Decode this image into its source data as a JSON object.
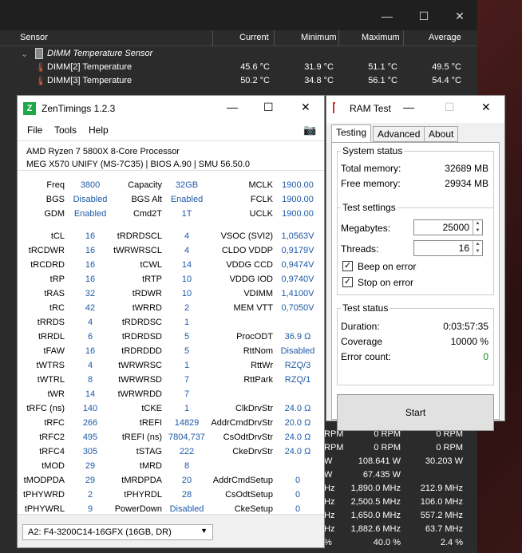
{
  "hwinfo": {
    "columns": [
      "Sensor",
      "Current",
      "Minimum",
      "Maximum",
      "Average"
    ],
    "group": "DIMM Temperature Sensor",
    "rows": [
      {
        "name": "DIMM[2] Temperature",
        "current": "45.6 °C",
        "min": "31.9 °C",
        "max": "51.1 °C",
        "avg": "49.5 °C"
      },
      {
        "name": "DIMM[3] Temperature",
        "current": "50.2 °C",
        "min": "34.8 °C",
        "max": "56.1 °C",
        "avg": "54.4 °C"
      }
    ],
    "lower_rows": [
      {
        "c": "RPM",
        "min": "0 RPM",
        "avg": "0 RPM"
      },
      {
        "c": "RPM",
        "min": "0 RPM",
        "avg": "0 RPM"
      },
      {
        "c": "W",
        "min": "108.641 W",
        "avg": "30.203 W"
      },
      {
        "c": "W",
        "min": "67.435 W",
        "avg": ""
      },
      {
        "c": "Hz",
        "min": "1,890.0 MHz",
        "avg": "212.9 MHz"
      },
      {
        "c": "Hz",
        "min": "2,500.5 MHz",
        "avg": "106.0 MHz"
      },
      {
        "c": "Hz",
        "min": "1,650.0 MHz",
        "avg": "557.2 MHz"
      },
      {
        "c": "Hz",
        "min": "1,882.6 MHz",
        "avg": "63.7 MHz"
      },
      {
        "c": "%",
        "min": "40.0 %",
        "avg": "2.4 %"
      }
    ]
  },
  "zentimings": {
    "title": "ZenTimings 1.2.3",
    "menu": [
      "File",
      "Tools",
      "Help"
    ],
    "cpu": "AMD Ryzen 7 5800X 8-Core Processor",
    "board": "MEG X570 UNIFY (MS-7C35) | BIOS A.90 | SMU 56.50.0",
    "top": [
      [
        "Freq",
        "3800",
        "Capacity",
        "32GB",
        "MCLK",
        "1900.00"
      ],
      [
        "BGS",
        "Disabled",
        "BGS Alt",
        "Enabled",
        "FCLK",
        "1900.00"
      ],
      [
        "GDM",
        "Enabled",
        "Cmd2T",
        "1T",
        "UCLK",
        "1900.00"
      ]
    ],
    "timings": [
      [
        "tCL",
        "16",
        "tRDRDSCL",
        "4",
        "VSOC (SVI2)",
        "1,0563V"
      ],
      [
        "tRCDWR",
        "16",
        "tWRWRSCL",
        "4",
        "CLDO VDDP",
        "0,9179V"
      ],
      [
        "tRCDRD",
        "16",
        "tCWL",
        "14",
        "VDDG CCD",
        "0,9474V"
      ],
      [
        "tRP",
        "16",
        "tRTP",
        "10",
        "VDDG IOD",
        "0,9740V"
      ],
      [
        "tRAS",
        "32",
        "tRDWR",
        "10",
        "VDIMM",
        "1,4100V"
      ],
      [
        "tRC",
        "42",
        "tWRRD",
        "2",
        "MEM VTT",
        "0,7050V"
      ],
      [
        "tRRDS",
        "4",
        "tRDRDSC",
        "1",
        "",
        ""
      ],
      [
        "tRRDL",
        "6",
        "tRDRDSD",
        "5",
        "ProcODT",
        "36.9 Ω"
      ],
      [
        "tFAW",
        "16",
        "tRDRDDD",
        "5",
        "RttNom",
        "Disabled"
      ],
      [
        "tWTRS",
        "4",
        "tWRWRSC",
        "1",
        "RttWr",
        "RZQ/3"
      ],
      [
        "tWTRL",
        "8",
        "tWRWRSD",
        "7",
        "RttPark",
        "RZQ/1"
      ],
      [
        "tWR",
        "14",
        "tWRWRDD",
        "7",
        "",
        ""
      ],
      [
        "tRFC (ns)",
        "140",
        "tCKE",
        "1",
        "ClkDrvStr",
        "24.0 Ω"
      ],
      [
        "tRFC",
        "266",
        "tREFI",
        "14829",
        "AddrCmdDrvStr",
        "20.0 Ω"
      ],
      [
        "tRFC2",
        "495",
        "tREFI (ns)",
        "7804,737",
        "CsOdtDrvStr",
        "24.0 Ω"
      ],
      [
        "tRFC4",
        "305",
        "tSTAG",
        "222",
        "CkeDrvStr",
        "24.0 Ω"
      ],
      [
        "tMOD",
        "29",
        "tMRD",
        "8",
        "",
        ""
      ],
      [
        "tMODPDA",
        "29",
        "tMRDPDA",
        "20",
        "AddrCmdSetup",
        "0"
      ],
      [
        "tPHYWRD",
        "2",
        "tPHYRDL",
        "28",
        "CsOdtSetup",
        "0"
      ],
      [
        "tPHYWRL",
        "9",
        "PowerDown",
        "Disabled",
        "CkeSetup",
        "0"
      ]
    ],
    "dimm_select": "A2: F4-3200C14-16GFX (16GB, DR)"
  },
  "ramtest": {
    "title": "RAM Test",
    "tabs": [
      "Testing",
      "Advanced",
      "About"
    ],
    "system_status": {
      "title": "System status",
      "total_label": "Total memory:",
      "total": "32689 MB",
      "free_label": "Free memory:",
      "free": "29934 MB"
    },
    "test_settings": {
      "title": "Test settings",
      "mb_label": "Megabytes:",
      "mb": "25000",
      "threads_label": "Threads:",
      "threads": "16",
      "beep": "Beep on error",
      "stop": "Stop on error"
    },
    "test_status": {
      "title": "Test status",
      "duration_label": "Duration:",
      "duration": "0:03:57:35",
      "coverage_label": "Coverage",
      "coverage": "10000 %",
      "errors_label": "Error count:",
      "errors": "0"
    },
    "start": "Start"
  },
  "colors": {
    "accent_blue": "#1e5aa8",
    "error_green": "#1a8a1a"
  }
}
